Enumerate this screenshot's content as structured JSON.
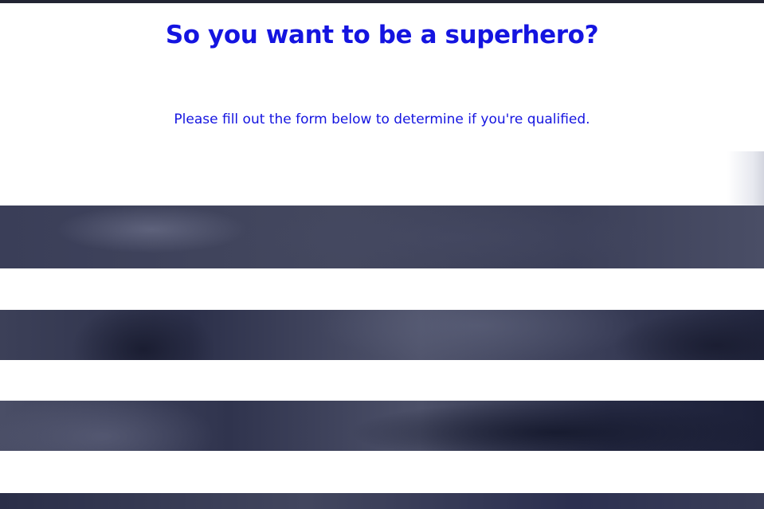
{
  "header": {
    "title": "So you want to be a superhero?",
    "subtitle": "Please fill out the form below to determine if you're qualified."
  },
  "colors": {
    "accent": "#1414e0",
    "top_bar": "#222433",
    "band_dark": "#2a2e48",
    "background": "#ffffff"
  },
  "form": {
    "fields": [
      {
        "label": "",
        "value": ""
      },
      {
        "label": "",
        "value": ""
      },
      {
        "label": "",
        "value": ""
      }
    ]
  }
}
